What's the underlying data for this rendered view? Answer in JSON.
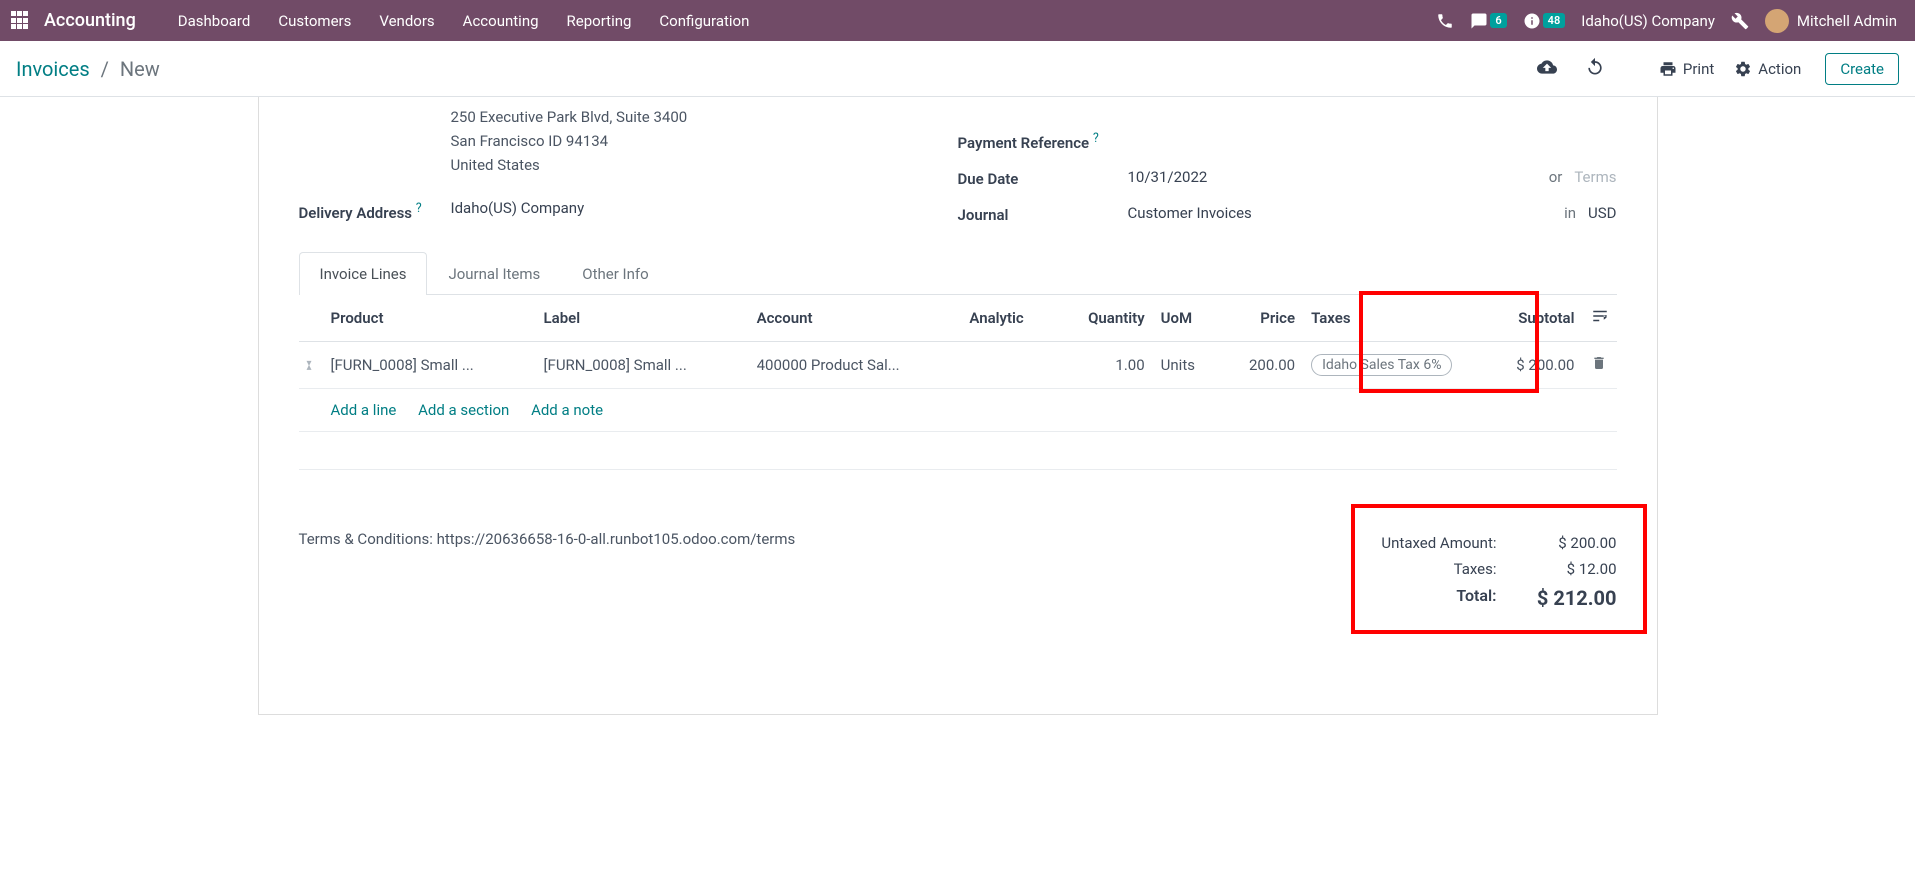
{
  "topbar": {
    "brand": "Accounting",
    "nav": [
      "Dashboard",
      "Customers",
      "Vendors",
      "Accounting",
      "Reporting",
      "Configuration"
    ],
    "msg_badge": "6",
    "activity_badge": "48",
    "company": "Idaho(US) Company",
    "user": "Mitchell Admin"
  },
  "controlbar": {
    "bc_root": "Invoices",
    "bc_current": "New",
    "print": "Print",
    "action": "Action",
    "create": "Create"
  },
  "form": {
    "address_l1": "250 Executive Park Blvd, Suite 3400",
    "address_l2": "San Francisco ID 94134",
    "address_l3": "United States",
    "delivery_label": "Delivery Address",
    "delivery_value": "Idaho(US) Company",
    "pay_ref_label": "Payment Reference",
    "due_label": "Due Date",
    "due_value": "10/31/2022",
    "due_or": "or",
    "terms_placeholder": "Terms",
    "journal_label": "Journal",
    "journal_value": "Customer Invoices",
    "journal_in": "in",
    "journal_curr": "USD"
  },
  "tabs": [
    "Invoice Lines",
    "Journal Items",
    "Other Info"
  ],
  "table": {
    "headers": {
      "product": "Product",
      "label": "Label",
      "account": "Account",
      "analytic": "Analytic",
      "quantity": "Quantity",
      "uom": "UoM",
      "price": "Price",
      "taxes": "Taxes",
      "subtotal": "Subtotal"
    },
    "row": {
      "product": "[FURN_0008] Small ...",
      "label": "[FURN_0008] Small ...",
      "account": "400000 Product Sal...",
      "analytic": "",
      "quantity": "1.00",
      "uom": "Units",
      "price": "200.00",
      "tax": "Idaho Sales Tax 6%",
      "subtotal": "$ 200.00"
    },
    "add_line": "Add a line",
    "add_section": "Add a section",
    "add_note": "Add a note"
  },
  "bottom": {
    "terms": "Terms & Conditions: https://20636658-16-0-all.runbot105.odoo.com/terms",
    "untaxed_label": "Untaxed Amount:",
    "untaxed_val": "$ 200.00",
    "taxes_label": "Taxes:",
    "taxes_val": "$ 12.00",
    "total_label": "Total:",
    "total_val": "$ 212.00"
  }
}
